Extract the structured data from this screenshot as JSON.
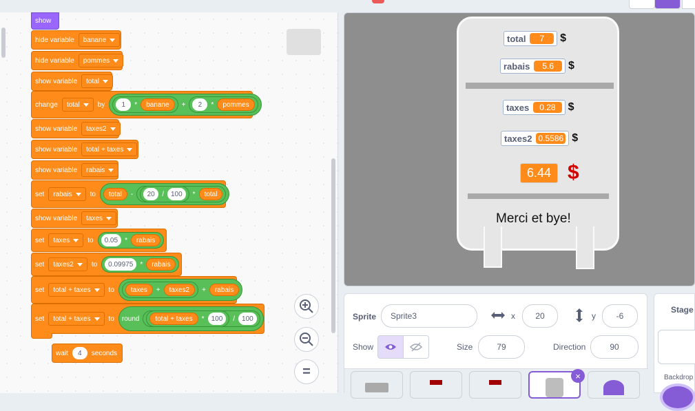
{
  "blocks": {
    "show": "show",
    "b1": {
      "verb": "hide variable",
      "var": "banane"
    },
    "b2": {
      "verb": "hide variable",
      "var": "pommes"
    },
    "b3": {
      "verb": "show variable",
      "var": "total"
    },
    "b4": {
      "verb": "change",
      "var": "total",
      "by": "by",
      "n1": "1",
      "op1": "*",
      "r1": "banane",
      "op2": "+",
      "n2": "2",
      "op3": "*",
      "r2": "pommes"
    },
    "b5": {
      "verb": "show variable",
      "var": "taxes2"
    },
    "b6": {
      "verb": "show variable",
      "var": "total + taxes"
    },
    "b7": {
      "verb": "show variable",
      "var": "rabais"
    },
    "b8": {
      "verb": "set",
      "var": "rabais",
      "to": "to",
      "r1": "total",
      "op1": "-",
      "n1": "20",
      "op2": "/",
      "n2": "100",
      "op3": "*",
      "r2": "total"
    },
    "b9": {
      "verb": "show variable",
      "var": "taxes"
    },
    "b10": {
      "verb": "set",
      "var": "taxes",
      "to": "to",
      "n1": "0.05",
      "op1": "*",
      "r1": "rabais"
    },
    "b11": {
      "verb": "set",
      "var": "taxes2",
      "to": "to",
      "n1": "0.09975",
      "op1": "*",
      "r1": "rabais"
    },
    "b12": {
      "verb": "set",
      "var": "total + taxes",
      "to": "to",
      "r1": "taxes",
      "op1": "+",
      "r2": "taxes2",
      "op2": "+",
      "r3": "rabais"
    },
    "b13": {
      "verb": "set",
      "var": "total + taxes",
      "to": "to",
      "fn": "round",
      "r1": "total + taxes",
      "op1": "*",
      "n1": "100",
      "op2": "/",
      "n2": "100"
    },
    "wait": {
      "verb": "wait",
      "n": "4",
      "unit": "seconds"
    }
  },
  "zoom": {
    "in": "+",
    "out": "-",
    "reset": "="
  },
  "stage": {
    "total": {
      "label": "total",
      "value": "7",
      "sym": "$"
    },
    "rabais": {
      "label": "rabais",
      "value": "5.6",
      "sym": "$"
    },
    "taxes": {
      "label": "taxes",
      "value": "0.28",
      "sym": "$"
    },
    "taxes2": {
      "label": "taxes2",
      "value": "0.5586",
      "sym": "$"
    },
    "grand": {
      "value": "6.44",
      "sym": "$"
    },
    "message": "Merci et bye!"
  },
  "sprite_info": {
    "sprite_label": "Sprite",
    "sprite_name": "Sprite3",
    "x_label": "x",
    "x": "20",
    "y_label": "y",
    "y": "-6",
    "show_label": "Show",
    "size_label": "Size",
    "size": "79",
    "direction_label": "Direction",
    "direction": "90"
  },
  "stage_panel": {
    "title": "Stage",
    "backdrops": "Backdrop"
  },
  "colors": {
    "motion_orange": "#ff8c1a",
    "operator_green": "#59c059",
    "looks_purple": "#9966ff",
    "accent": "#855cd6"
  }
}
